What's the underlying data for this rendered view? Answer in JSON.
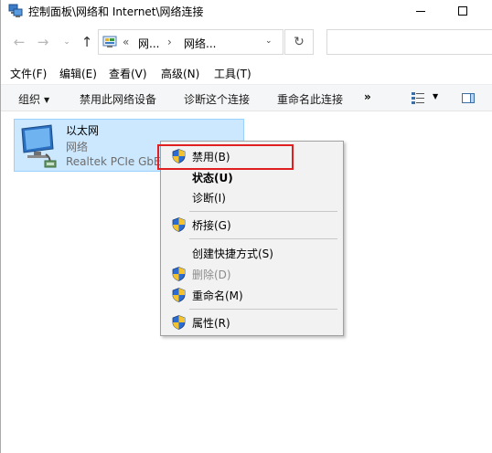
{
  "window": {
    "title": "控制面板\\网络和 Internet\\网络连接"
  },
  "address": {
    "prefix": "«",
    "crumb1": "网...",
    "separator": "›",
    "crumb2": "网络...",
    "search_placeholder": ""
  },
  "nav": {
    "back_icon": "←",
    "forward_icon": "→",
    "recent_icon": "⌄",
    "up_icon": "↑",
    "dropdown_icon": "⌄",
    "refresh_icon": "↻"
  },
  "menubar": {
    "items": [
      "文件(F)",
      "编辑(E)",
      "查看(V)",
      "高级(N)",
      "工具(T)"
    ]
  },
  "commandbar": {
    "organize": "组织",
    "disable_device": "禁用此网络设备",
    "diagnose": "诊断这个连接",
    "rename": "重命名此连接",
    "more": "»"
  },
  "connection": {
    "name": "以太网",
    "type": "网络",
    "adapter": "Realtek PCIe GbE"
  },
  "context_menu": {
    "items": [
      {
        "label": "禁用(B)",
        "shield": true,
        "bold": false,
        "disabled": false
      },
      {
        "label": "状态(U)",
        "shield": false,
        "bold": true,
        "disabled": false
      },
      {
        "label": "诊断(I)",
        "shield": false,
        "bold": false,
        "disabled": false
      },
      {
        "label": "桥接(G)",
        "shield": true,
        "bold": false,
        "disabled": false
      },
      {
        "label": "创建快捷方式(S)",
        "shield": false,
        "bold": false,
        "disabled": false
      },
      {
        "label": "删除(D)",
        "shield": true,
        "bold": false,
        "disabled": true
      },
      {
        "label": "重命名(M)",
        "shield": true,
        "bold": false,
        "disabled": false
      },
      {
        "label": "属性(R)",
        "shield": true,
        "bold": false,
        "disabled": false
      }
    ]
  },
  "colors": {
    "selection_bg": "#cce8ff",
    "selection_border": "#99d1ff",
    "highlight_box": "#e02020",
    "menu_bg": "#f2f2f2"
  }
}
